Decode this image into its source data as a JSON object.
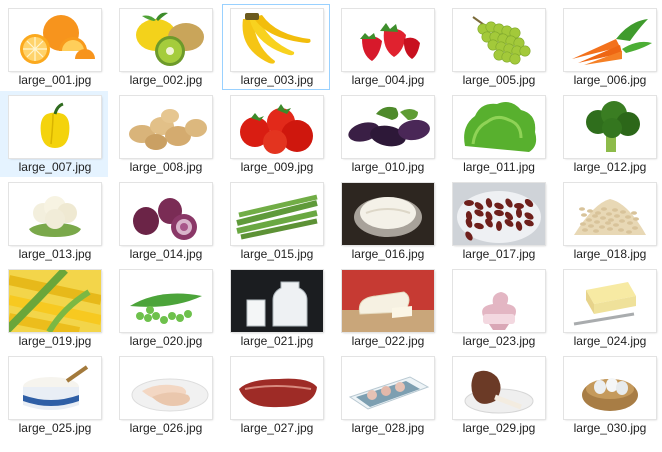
{
  "files": [
    {
      "name": "large_001.jpg",
      "icon": "orange-slices-icon"
    },
    {
      "name": "large_002.jpg",
      "icon": "lemon-kiwi-icon"
    },
    {
      "name": "large_003.jpg",
      "icon": "bananas-icon",
      "state": "selected"
    },
    {
      "name": "large_004.jpg",
      "icon": "strawberries-icon"
    },
    {
      "name": "large_005.jpg",
      "icon": "green-grapes-icon"
    },
    {
      "name": "large_006.jpg",
      "icon": "carrots-icon"
    },
    {
      "name": "large_007.jpg",
      "icon": "yellow-pepper-icon",
      "state": "hover"
    },
    {
      "name": "large_008.jpg",
      "icon": "potatoes-icon"
    },
    {
      "name": "large_009.jpg",
      "icon": "tomatoes-icon"
    },
    {
      "name": "large_010.jpg",
      "icon": "eggplants-icon"
    },
    {
      "name": "large_011.jpg",
      "icon": "lettuce-icon"
    },
    {
      "name": "large_012.jpg",
      "icon": "broccoli-icon"
    },
    {
      "name": "large_013.jpg",
      "icon": "cauliflower-icon"
    },
    {
      "name": "large_014.jpg",
      "icon": "red-onions-icon"
    },
    {
      "name": "large_015.jpg",
      "icon": "asparagus-icon"
    },
    {
      "name": "large_016.jpg",
      "icon": "rice-bowl-icon"
    },
    {
      "name": "large_017.jpg",
      "icon": "kidney-beans-icon"
    },
    {
      "name": "large_018.jpg",
      "icon": "oats-icon"
    },
    {
      "name": "large_019.jpg",
      "icon": "corn-icon"
    },
    {
      "name": "large_020.jpg",
      "icon": "peas-icon"
    },
    {
      "name": "large_021.jpg",
      "icon": "milk-icon"
    },
    {
      "name": "large_022.jpg",
      "icon": "brie-cheese-icon"
    },
    {
      "name": "large_023.jpg",
      "icon": "frozen-yogurt-icon"
    },
    {
      "name": "large_024.jpg",
      "icon": "butter-icon"
    },
    {
      "name": "large_025.jpg",
      "icon": "cream-cheese-icon"
    },
    {
      "name": "large_026.jpg",
      "icon": "sliced-turkey-icon"
    },
    {
      "name": "large_027.jpg",
      "icon": "beef-ribs-icon"
    },
    {
      "name": "large_028.jpg",
      "icon": "shrimp-tray-icon"
    },
    {
      "name": "large_029.jpg",
      "icon": "lamb-shank-icon"
    },
    {
      "name": "large_030.jpg",
      "icon": "egg-basket-icon"
    }
  ],
  "colors": {
    "selected_border": "#99d1ff",
    "hover_background": "#e5f3ff",
    "label_text": "#1f1f1f"
  }
}
